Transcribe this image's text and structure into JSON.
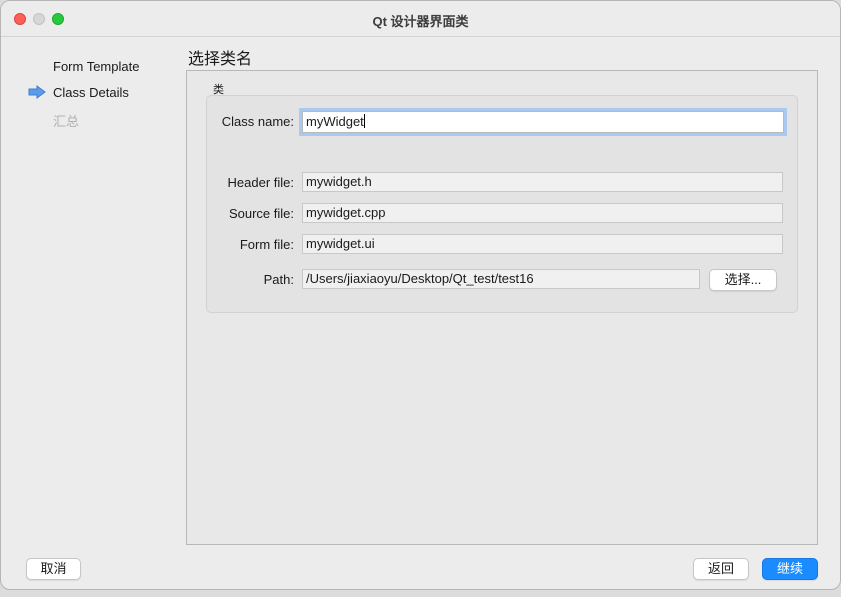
{
  "window": {
    "title": "Qt 设计器界面类"
  },
  "sidebar": {
    "items": [
      {
        "label": "Form Template",
        "state": "done"
      },
      {
        "label": "Class Details",
        "state": "current"
      },
      {
        "label": "汇总",
        "state": "pending"
      }
    ]
  },
  "page": {
    "title": "选择类名"
  },
  "group": {
    "title": "类"
  },
  "form": {
    "class_name": {
      "label": "Class name:",
      "value": "myWidget"
    },
    "header_file": {
      "label": "Header file:",
      "value": "mywidget.h"
    },
    "source_file": {
      "label": "Source file:",
      "value": "mywidget.cpp"
    },
    "form_file": {
      "label": "Form file:",
      "value": "mywidget.ui"
    },
    "path": {
      "label": "Path:",
      "value": "/Users/jiaxiaoyu/Desktop/Qt_test/test16"
    },
    "browse_label": "选择..."
  },
  "footer": {
    "cancel_label": "取消",
    "back_label": "返回",
    "next_label": "继续"
  },
  "colors": {
    "accent": "#1a8cff",
    "focus_ring": "#a9c8f2",
    "current_step_arrow": "#5b9bea"
  }
}
